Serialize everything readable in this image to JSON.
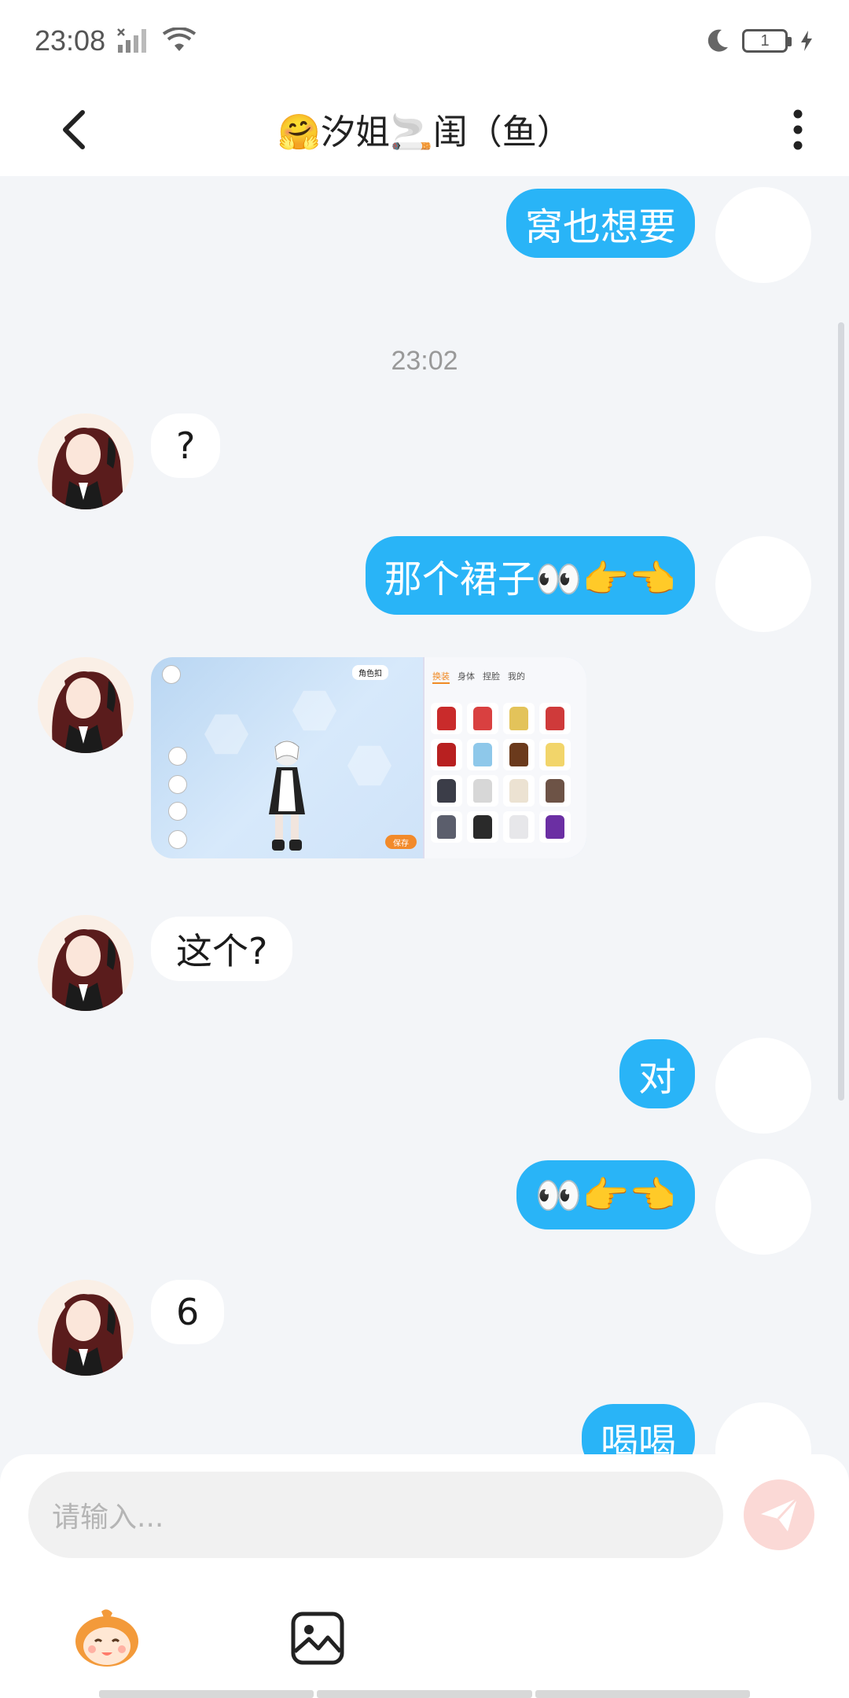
{
  "status_bar": {
    "time": "23:08",
    "battery": "1"
  },
  "header": {
    "title": "🤗汐姐🚬闺（鱼）"
  },
  "messages": {
    "m1": "窝也想要",
    "timestamp": "23:02",
    "m2": "?",
    "m3": "那个裙子👀👉👈",
    "image": {
      "role_button": "角色扣",
      "tabs": [
        "换装",
        "身体",
        "捏脸",
        "我的"
      ],
      "save": "保存"
    },
    "m4": "这个?",
    "m5": "对",
    "m6": "👀👉👈",
    "m7": "6",
    "m8": "喝喝"
  },
  "input": {
    "placeholder": "请输入..."
  },
  "colors": {
    "accent": "#29b4f7",
    "send_disabled": "#fbd9d6",
    "background": "#f3f5f8"
  }
}
